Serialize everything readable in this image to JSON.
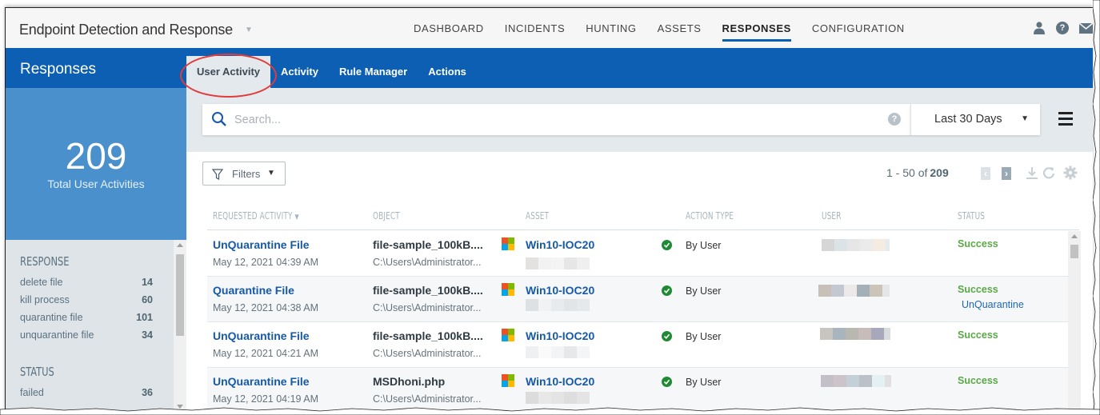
{
  "app": {
    "title": "Endpoint Detection and Response",
    "nav": [
      {
        "label": "DASHBOARD",
        "active": false
      },
      {
        "label": "INCIDENTS",
        "active": false
      },
      {
        "label": "HUNTING",
        "active": false
      },
      {
        "label": "ASSETS",
        "active": false
      },
      {
        "label": "RESPONSES",
        "active": true
      },
      {
        "label": "CONFIGURATION",
        "active": false
      }
    ],
    "icons": [
      "user-icon",
      "help-icon",
      "mail-icon"
    ]
  },
  "section": {
    "title": "Responses",
    "subtabs": [
      {
        "label": "User Activity",
        "active": true,
        "highlighted": true
      },
      {
        "label": "Activity",
        "active": false
      },
      {
        "label": "Rule Manager",
        "active": false
      },
      {
        "label": "Actions",
        "active": false
      }
    ]
  },
  "summary": {
    "total": "209",
    "label": "Total User Activities"
  },
  "sidebar": {
    "groups": [
      {
        "heading": "RESPONSE",
        "items": [
          {
            "label": "delete file",
            "count": "14"
          },
          {
            "label": "kill process",
            "count": "60"
          },
          {
            "label": "quarantine file",
            "count": "101"
          },
          {
            "label": "unquarantine file",
            "count": "34"
          }
        ]
      },
      {
        "heading": "STATUS",
        "items": [
          {
            "label": "failed",
            "count": "36"
          }
        ]
      }
    ]
  },
  "search": {
    "placeholder": "Search...",
    "value": "",
    "range": "Last 30 Days"
  },
  "toolbar": {
    "filters_label": "Filters",
    "pager_text": "1 - 50 of",
    "pager_total": "209"
  },
  "table": {
    "columns": [
      "REQUESTED ACTIVITY",
      "OBJECT",
      "ASSET",
      "ACTION TYPE",
      "USER",
      "STATUS"
    ],
    "sort_column": "REQUESTED ACTIVITY",
    "rows": [
      {
        "activity": "UnQuarantine File",
        "date": "May 12, 2021 04:39 AM",
        "object": "file-sample_100kB....",
        "path": "C:\\Users\\Administrator...",
        "asset": "Win10-IOC20",
        "action_type": "By User",
        "status": "Success",
        "status_sub": ""
      },
      {
        "activity": "Quarantine File",
        "date": "May 12, 2021 04:38 AM",
        "object": "file-sample_100kB....",
        "path": "C:\\Users\\Administrator...",
        "asset": "Win10-IOC20",
        "action_type": "By User",
        "status": "Success",
        "status_sub": "UnQuarantine"
      },
      {
        "activity": "UnQuarantine File",
        "date": "May 12, 2021 04:21 AM",
        "object": "file-sample_100kB....",
        "path": "C:\\Users\\Administrator...",
        "asset": "Win10-IOC20",
        "action_type": "By User",
        "status": "Success",
        "status_sub": ""
      },
      {
        "activity": "UnQuarantine File",
        "date": "May 12, 2021 04:19 AM",
        "object": "MSDhoni.php",
        "path": "C:\\Users\\Administrator...",
        "asset": "Win10-IOC20",
        "action_type": "By User",
        "status": "Success",
        "status_sub": ""
      }
    ]
  },
  "colors": {
    "brand_blue": "#0c5fb3",
    "summary_blue": "#4a90cc",
    "link_blue": "#1659a8",
    "success_green": "#5aa846",
    "annotation_red": "#e23b3b"
  }
}
